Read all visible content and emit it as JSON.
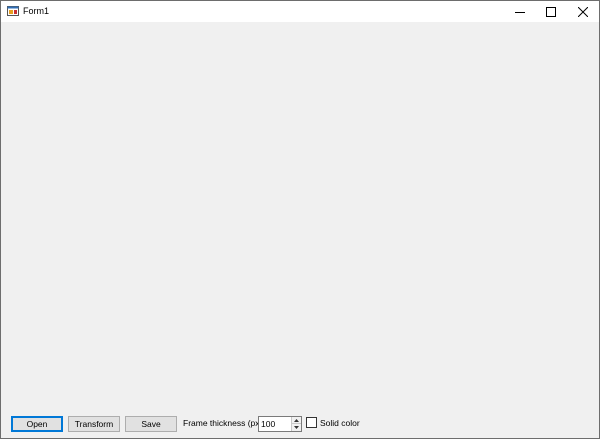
{
  "window": {
    "title": "Form1"
  },
  "toolbar": {
    "open_label": "Open",
    "transform_label": "Transform",
    "save_label": "Save",
    "frame_thickness_label": "Frame thickness (px)",
    "frame_thickness_value": "100",
    "solid_color_label": "Solid color",
    "solid_color_checked": false
  },
  "icons": {
    "app": "app-icon",
    "minimize": "minimize-icon",
    "maximize": "maximize-icon",
    "close": "close-icon",
    "spin_up": "chevron-up-icon",
    "spin_down": "chevron-down-icon"
  }
}
